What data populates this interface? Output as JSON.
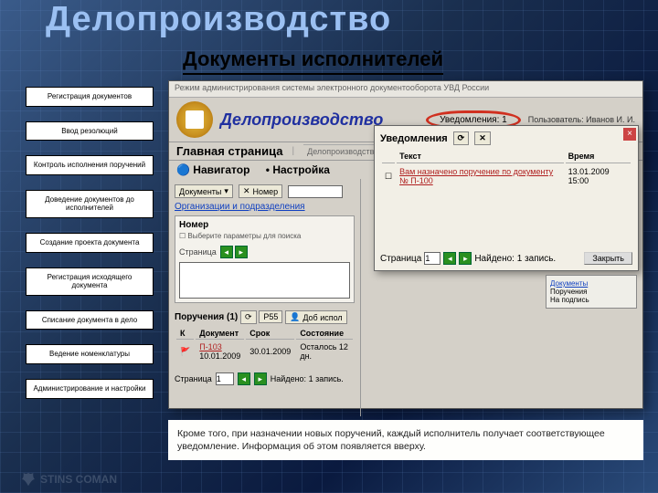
{
  "title": "Делопроизводство",
  "subtitle": "Документы исполнителей",
  "sidebar": {
    "items": [
      {
        "label": "Регистрация документов"
      },
      {
        "label": "Ввод резолюций"
      },
      {
        "label": "Контроль исполнения поручений"
      },
      {
        "label": "Доведение документов до исполнителей"
      },
      {
        "label": "Создание проекта документа"
      },
      {
        "label": "Регистрация исходящего документа"
      },
      {
        "label": "Списание документа в дело"
      },
      {
        "label": "Ведение номенклатуры"
      },
      {
        "label": "Администрирование и настройки"
      }
    ]
  },
  "brand": "STINS  COMAN",
  "app": {
    "topline": "Режим администрирования системы электронного документооборота УВД России",
    "title": "Делопроизводство",
    "notif_badge": "Уведомления: 1",
    "user_prefix": "Пользователь:",
    "user_name": "Иванов И. И.",
    "main_page": "Главная страница",
    "nav": {
      "navigator": "Навигатор",
      "settings": "Настройка"
    },
    "left": {
      "docs_lbl": "Документы",
      "orgs": "Организации и подразделения",
      "num_lbl": "Номер",
      "num_hdr": "Номер",
      "hint": "Выберите параметры для поиска",
      "page_lbl": "Страница",
      "por_header": "Поручения (1)",
      "tb_r55": "Р55",
      "tb_add": "Доб испол",
      "col_k": "К",
      "col_doc": "Документ",
      "col_term": "Срок",
      "col_state": "Состояние",
      "doc_no": "П-103",
      "doc_date": "10.01.2009",
      "term": "30.01.2009",
      "state": "Осталось 12 дн.",
      "pages_lbl": "Страница",
      "pages_val": "1",
      "found": "Найдено: 1 запись."
    },
    "popup": {
      "title": "Уведомления",
      "refresh_icon": "refresh",
      "col_text": "Текст",
      "col_time": "Время",
      "msg": "Вам назначено поручение по документу № П-100",
      "time": "13.01.2009 15:00",
      "page_lbl": "Страница",
      "page_val": "1",
      "found": "Найдено: 1 запись.",
      "close_btn": "Закрыть"
    },
    "tabs_line": "Делопроизводство    Домашняя почта пользователя",
    "mini": {
      "l1": "Документы",
      "l2": "Поручения",
      "l3": "На подпись"
    }
  },
  "caption": "Кроме того, при назначении новых поручений, каждый исполнитель получает соответствующее уведомление. Информация об этом появляется вверху."
}
